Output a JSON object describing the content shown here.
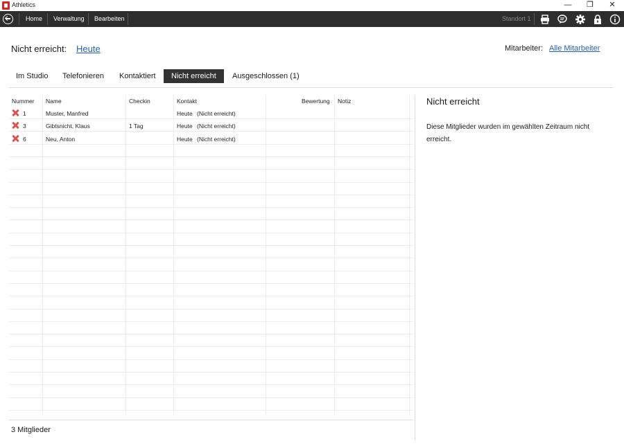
{
  "window": {
    "title": "Athletics",
    "min_glyph": "—",
    "max_glyph": "❐",
    "close_glyph": "✕"
  },
  "toolbar": {
    "items": [
      "Home",
      "Verwaltung",
      "Bearbeiten"
    ],
    "standort": "Standort 1",
    "icons": [
      "back-icon",
      "printer-icon",
      "chat-icon",
      "gear-icon",
      "lock-icon",
      "info-icon"
    ]
  },
  "header": {
    "label": "Nicht erreicht:",
    "date_link": "Heute",
    "mitarbeiter_label": "Mitarbeiter:",
    "mitarbeiter_link": "Alle Mitarbeiter"
  },
  "tabs": [
    {
      "label": "Im Studio",
      "active": false
    },
    {
      "label": "Telefonieren",
      "active": false
    },
    {
      "label": "Kontaktiert",
      "active": false
    },
    {
      "label": "Nicht erreicht",
      "active": true
    },
    {
      "label": "Ausgeschlossen (1)",
      "active": false
    }
  ],
  "table": {
    "columns": [
      "Nummer",
      "Name",
      "Checkin",
      "Kontakt",
      "Bewertung",
      "Notiz"
    ],
    "rows": [
      {
        "nummer": "1",
        "name": "Muster, Manfred",
        "checkin": "",
        "kontakt_day": "Heute",
        "kontakt_status": "(Nicht erreicht)",
        "bewertung": "",
        "notiz": ""
      },
      {
        "nummer": "3",
        "name": "Gibtsnicht, Klaus",
        "checkin": "1 Tag",
        "kontakt_day": "Heute",
        "kontakt_status": "(Nicht erreicht)",
        "bewertung": "",
        "notiz": ""
      },
      {
        "nummer": "6",
        "name": "Neu, Anton",
        "checkin": "",
        "kontakt_day": "Heute",
        "kontakt_status": "(Nicht erreicht)",
        "bewertung": "",
        "notiz": ""
      }
    ]
  },
  "footer": {
    "count": "3 Mitglieder"
  },
  "side": {
    "title": "Nicht erreicht",
    "text": "Diese Mitglieder wurden im gewählten Zeitraum nicht erreicht."
  },
  "colors": {
    "toolbar_bg": "#2e2e2e",
    "active_tab_bg": "#333333",
    "link": "#1f5fbf",
    "status_x": "#d9534f",
    "logo": "#d42a2a"
  }
}
